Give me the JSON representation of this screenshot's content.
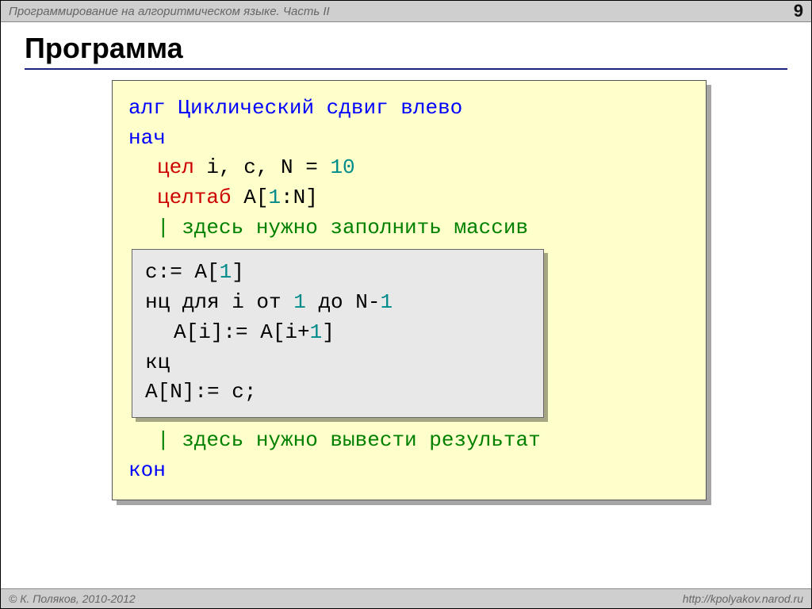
{
  "topbar": {
    "subject": "Программирование на алгоритмическом языке. Часть II",
    "page": "9"
  },
  "title": "Программа",
  "code": {
    "alg_kw": "алг",
    "alg_name": "Циклический сдвиг влево",
    "nach": "нач",
    "cel_kw": "цел",
    "cel_vars_pre": " i, c, N",
    "eq": " = ",
    "ten": "10",
    "celtab_kw": "целтаб",
    "celtab_a_pre": " A[",
    "one_a": "1",
    "celtab_a_post": ":N]",
    "comment1": "| здесь нужно заполнить массив",
    "inner": {
      "l1_pre": "c:= A[",
      "l1_num": "1",
      "l1_post": "]",
      "l2_pre": "нц для i от ",
      "l2_num1": "1",
      "l2_mid": " до N-",
      "l2_num2": "1",
      "l3_pre": "A[i]:= A[i+",
      "l3_num": "1",
      "l3_post": "]",
      "l4": "кц",
      "l5": "A[N]:= c;"
    },
    "comment2": "| здесь нужно вывести результат",
    "kon": "кон"
  },
  "footer": {
    "copyright": "© К. Поляков, 2010-2012",
    "url": "http://kpolyakov.narod.ru"
  }
}
